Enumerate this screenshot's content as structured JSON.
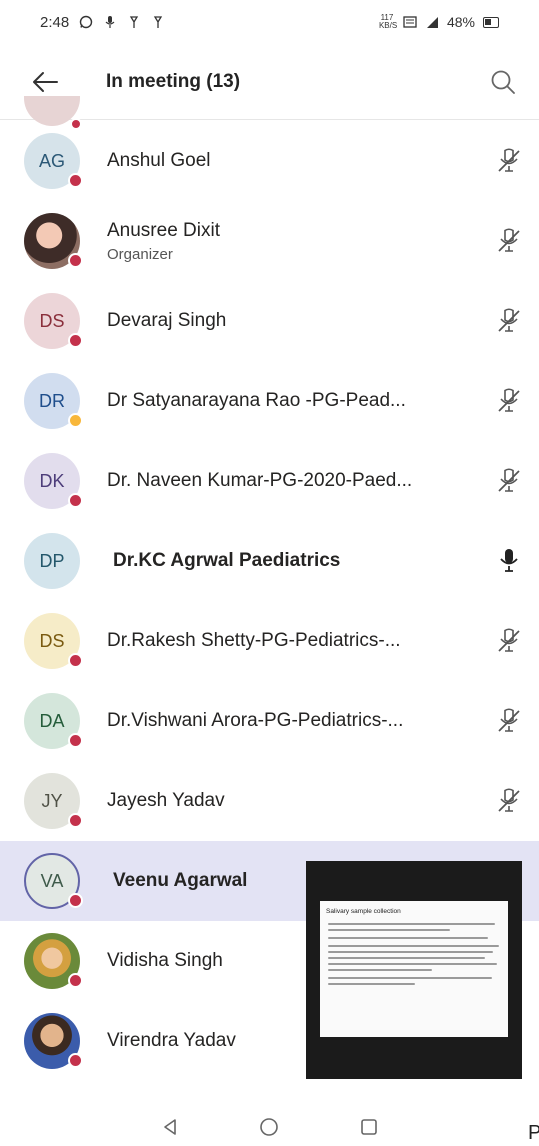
{
  "status_bar": {
    "time": "2:48",
    "battery": "48%",
    "data_rate": "117 KB/S"
  },
  "header": {
    "title": "In meeting (13)"
  },
  "colors": {
    "accent": "#6264a7",
    "busy": "#c4314b",
    "away": "#f8b73b",
    "selected_row": "#e3e3f4"
  },
  "participants": [
    {
      "initials": "AG",
      "name": "Anshul Goel",
      "role": "",
      "presence": "busy",
      "mic": "muted"
    },
    {
      "initials": "",
      "name": "Anusree Dixit",
      "role": "Organizer",
      "presence": "busy",
      "mic": "muted"
    },
    {
      "initials": "DS",
      "name": "Devaraj Singh",
      "role": "",
      "presence": "busy",
      "mic": "muted"
    },
    {
      "initials": "DR",
      "name": "Dr Satyanarayana  Rao -PG-Pead...",
      "role": "",
      "presence": "away",
      "mic": "muted"
    },
    {
      "initials": "DK",
      "name": "Dr. Naveen  Kumar-PG-2020-Paed...",
      "role": "",
      "presence": "busy",
      "mic": "muted"
    },
    {
      "initials": "DP",
      "name": "Dr.KC Agrwal Paediatrics",
      "role": "",
      "presence": "none",
      "mic": "on"
    },
    {
      "initials": "DS",
      "name": "Dr.Rakesh Shetty-PG-Pediatrics-...",
      "role": "",
      "presence": "busy",
      "mic": "muted"
    },
    {
      "initials": "DA",
      "name": "Dr.Vishwani Arora-PG-Pediatrics-...",
      "role": "",
      "presence": "busy",
      "mic": "muted"
    },
    {
      "initials": "JY",
      "name": "Jayesh Yadav",
      "role": "",
      "presence": "busy",
      "mic": "muted"
    },
    {
      "initials": "VA",
      "name": "Veenu Agarwal",
      "role": "",
      "presence": "busy",
      "mic": "none"
    },
    {
      "initials": "",
      "name": "Vidisha Singh",
      "role": "",
      "presence": "busy",
      "mic": "none"
    },
    {
      "initials": "",
      "name": "Virendra Yadav",
      "role": "",
      "presence": "busy",
      "mic": "none"
    }
  ],
  "shared_screen": {
    "doc_title": "Salivary sample collection"
  }
}
